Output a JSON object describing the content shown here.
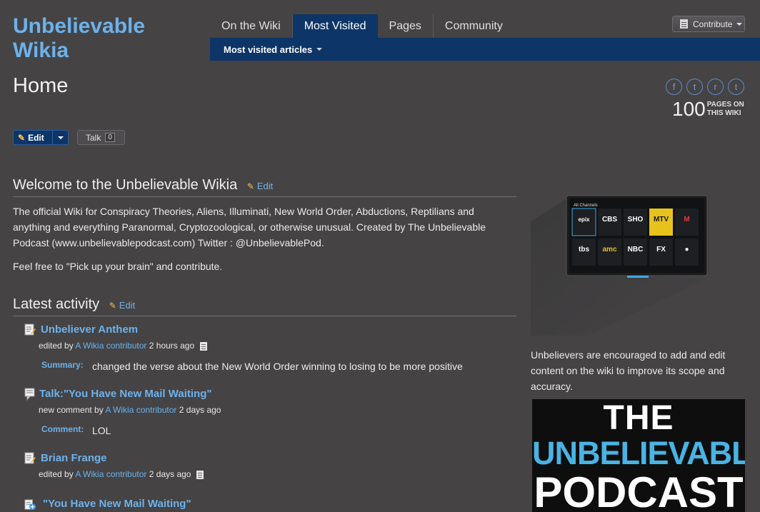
{
  "wiki": {
    "title": "Unbelievable Wikia"
  },
  "nav": {
    "tabs": [
      "On the Wiki",
      "Most Visited",
      "Pages",
      "Community"
    ],
    "active": "Most Visited",
    "subnav_label": "Most visited articles",
    "contribute_label": "Contribute"
  },
  "page": {
    "title": "Home",
    "edit_label": "Edit",
    "talk_label": "Talk",
    "talk_count": "0",
    "page_count": "100",
    "page_count_label_1": "PAGES ON",
    "page_count_label_2": "THIS WIKI"
  },
  "share": {
    "facebook": "f",
    "twitter": "t",
    "reddit": "r",
    "tumblr": "t"
  },
  "welcome": {
    "heading": "Welcome to the Unbelievable Wikia",
    "edit_link": "Edit",
    "paragraph": "The official Wiki for Conspiracy Theories, Aliens, Illuminati, New World Order, Abductions, Reptilians and anything and everything Paranormal, Cryptozoological, or otherwise unusual. Created by The Unbelievable Podcast (www.unbelievablepodcast.com) Twitter : @UnbelievablePod.",
    "paragraph2": "Feel free to \"Pick up your brain\" and contribute."
  },
  "activity": {
    "heading": "Latest activity",
    "edit_link": "Edit",
    "items": [
      {
        "title": "Unbeliever Anthem",
        "action": "edited by",
        "user": "A Wikia contributor",
        "time": "2 hours ago",
        "label": "Summary:",
        "text": "changed the verse about the New World Order winning to losing to be more positive"
      },
      {
        "title": "Talk:\"You Have New Mail Waiting\"",
        "action": "new comment by",
        "user": "A Wikia contributor",
        "time": "2 days ago",
        "label": "Comment:",
        "text": "LOL"
      },
      {
        "title": "Brian Frange",
        "action": "edited by",
        "user": "A Wikia contributor",
        "time": "2 days ago"
      },
      {
        "title": "\"You Have New Mail Waiting\""
      }
    ]
  },
  "sidebar": {
    "text": "Unbelievers are encouraged to add and edit content on the wiki to improve its scope and accuracy.",
    "podcast_line1": "THE",
    "podcast_line2": "UNBELIEVABLE",
    "podcast_line3": "PODCAST",
    "tv_header": "All Channels",
    "channels_row1": [
      "epix",
      "CBS",
      "SHO",
      "MTV",
      "M"
    ],
    "channels_row2": [
      "tbs",
      "amc",
      "NBC",
      "FX",
      "●"
    ]
  },
  "colors": {
    "background": "#454344",
    "accent_blue": "#0d3567",
    "link": "#6cb2ec"
  }
}
